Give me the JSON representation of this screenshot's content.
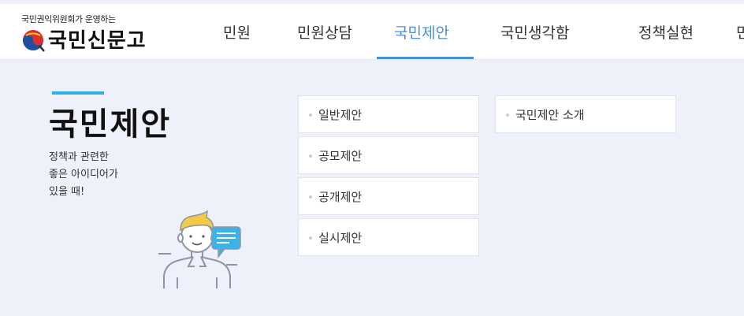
{
  "header": {
    "logo_subtitle": "국민권익위원회가 운영하는",
    "logo_title": "국민신문고",
    "nav": [
      {
        "label": "민원"
      },
      {
        "label": "민원상담"
      },
      {
        "label": "국민제안"
      },
      {
        "label": "국민생각함"
      },
      {
        "label": "정책실현"
      },
      {
        "label": "민"
      }
    ],
    "active_nav": "국민제안",
    "accent_color": "#4a8fd6"
  },
  "section": {
    "title": "국민제안",
    "description_lines": [
      "정책과 관련한",
      "좋은 아이디어가",
      "있을 때!"
    ],
    "title_bar_color": "#2eb1e4",
    "illustration_icon": "idea-person-speech-bubble-icon"
  },
  "menu": {
    "column1": [
      {
        "label": "일반제안"
      },
      {
        "label": "공모제안"
      },
      {
        "label": "공개제안"
      },
      {
        "label": "실시제안"
      }
    ],
    "column2": [
      {
        "label": "국민제안 소개"
      }
    ]
  }
}
